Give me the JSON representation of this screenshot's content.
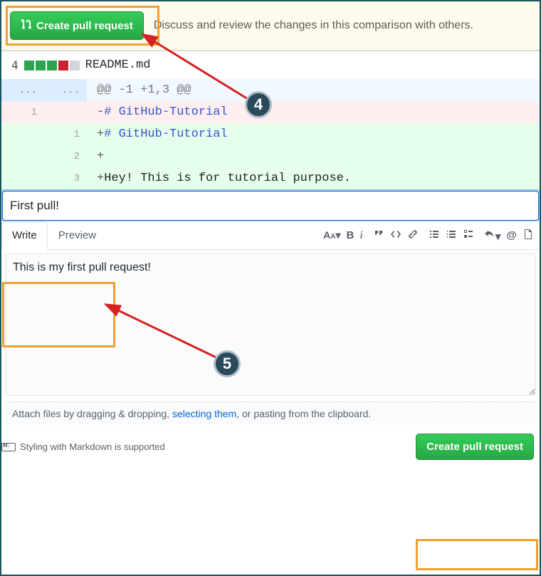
{
  "banner": {
    "create_pr_label": "Create pull request",
    "hint": "Discuss and review the changes in this comparison with others."
  },
  "diff": {
    "change_count": "4",
    "squares": [
      "add",
      "add",
      "add",
      "del",
      "neu"
    ],
    "file_name": "README.md",
    "hunk_header": "@@ -1 +1,3 @@",
    "rows": [
      {
        "type": "del",
        "old": "1",
        "new": "",
        "prefix": "-",
        "kw": "# GitHub-Tutorial",
        "txt": ""
      },
      {
        "type": "add",
        "old": "",
        "new": "1",
        "prefix": "+",
        "kw": "# GitHub-Tutorial",
        "txt": ""
      },
      {
        "type": "add",
        "old": "",
        "new": "2",
        "prefix": "+",
        "kw": "",
        "txt": ""
      },
      {
        "type": "add",
        "old": "",
        "new": "3",
        "prefix": "+",
        "kw": "",
        "txt": "Hey! This is for tutorial purpose."
      }
    ]
  },
  "pr_form": {
    "title_value": "First pull!",
    "tabs": {
      "write": "Write",
      "preview": "Preview"
    },
    "body_value": "This is my first pull request!",
    "attach_pre": "Attach files by dragging & dropping, ",
    "attach_link": "selecting them",
    "attach_post": ", or pasting from the clipboard.",
    "markdown_hint": "Styling with Markdown is supported",
    "submit_label": "Create pull request"
  },
  "annotations": {
    "step4": "4",
    "step5": "5"
  }
}
